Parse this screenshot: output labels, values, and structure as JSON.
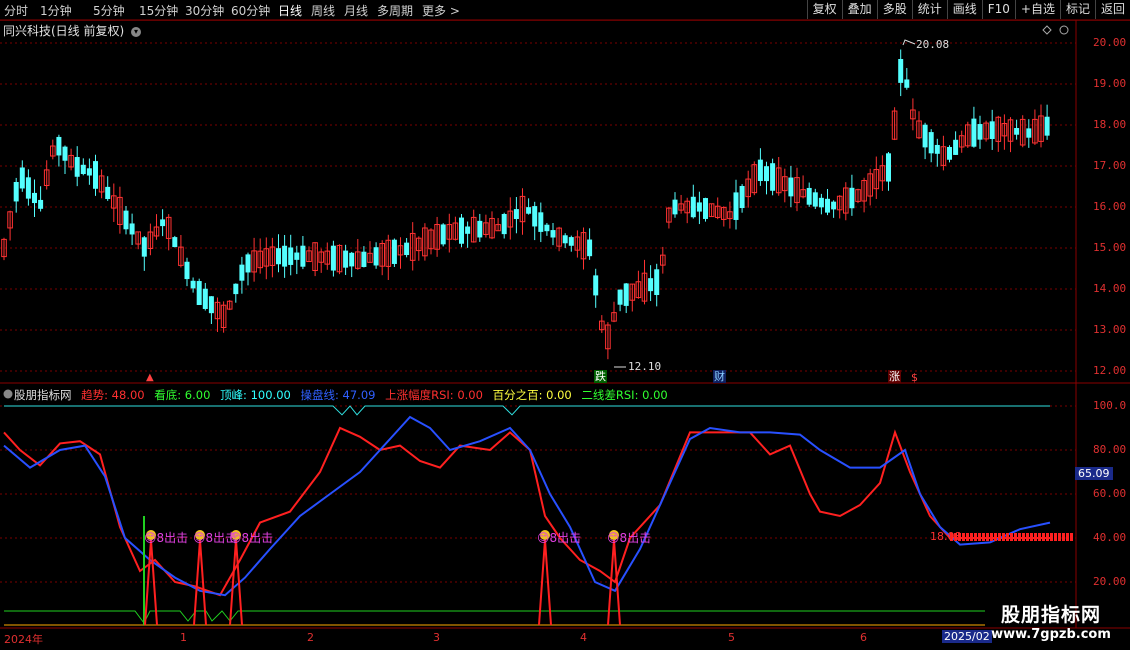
{
  "toolbar": {
    "periods": [
      "分时",
      "1分钟",
      "5分钟",
      "15分钟",
      "30分钟",
      "60分钟",
      "日线",
      "周线",
      "月线",
      "多周期",
      "更多 >"
    ],
    "active_period": "日线",
    "buttons": [
      "复权",
      "叠加",
      "多股",
      "统计",
      "画线",
      "F10",
      "+自选",
      "标记",
      "返回"
    ]
  },
  "stock": {
    "title": "同兴科技(日线 前复权)"
  },
  "price_axis": {
    "ticks": [
      "20.00",
      "19.00",
      "18.00",
      "17.00",
      "16.00",
      "15.00",
      "14.00",
      "13.00",
      "12.00"
    ],
    "high_label": "20.08",
    "low_label": "12.10"
  },
  "indicator": {
    "name": "股朋指标网",
    "items": [
      {
        "label": "趋势: 48.00",
        "color": "#ff3030"
      },
      {
        "label": "看底: 6.00",
        "color": "#30ff30"
      },
      {
        "label": "顶峰: 100.00",
        "color": "#30ffff"
      },
      {
        "label": "操盘线: 47.09",
        "color": "#3060ff"
      },
      {
        "label": "上涨幅度RSI: 0.00",
        "color": "#ff3030"
      },
      {
        "label": "百分之百: 0.00",
        "color": "#ffff40"
      },
      {
        "label": "二线差RSI: 0.00",
        "color": "#30ff30"
      }
    ],
    "axis_ticks": [
      "100.0",
      "80.00",
      "60.00",
      "40.00",
      "20.00"
    ],
    "current_value": "65.09",
    "signal_text": "😊8出击",
    "signal_text_alt": "18.08"
  },
  "event_markers": [
    "跌",
    "财",
    "涨"
  ],
  "time_axis": {
    "labels": [
      "2024年",
      "1",
      "2",
      "3",
      "4",
      "5",
      "6"
    ],
    "current_date": "2025/02"
  },
  "watermark": {
    "line1": "股朋指标网",
    "line2": "www.7gpzb.com"
  },
  "colors": {
    "up": "#ff3232",
    "down": "#54ffff",
    "grid": "#7a0000",
    "trend": "#ff2020",
    "operate": "#2850ff",
    "top": "#30e0e0",
    "bottom": "#20d020"
  }
}
